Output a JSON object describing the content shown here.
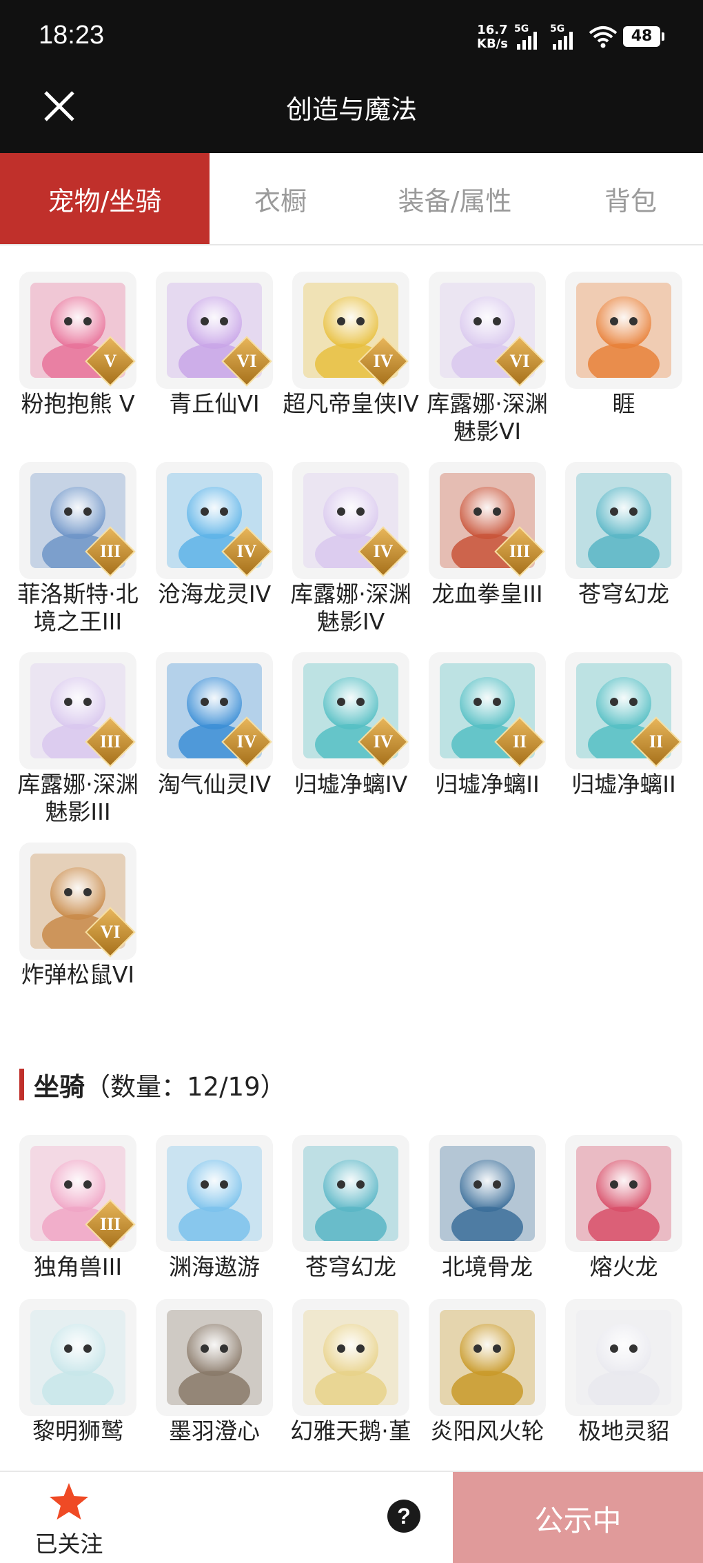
{
  "status": {
    "time": "18:23",
    "net_rate_value": "16.7",
    "net_rate_unit": "KB/s",
    "sim1": "5G",
    "sim2": "5G",
    "battery": "48"
  },
  "header": {
    "title": "创造与魔法",
    "close_icon": "close-icon"
  },
  "tabs": [
    {
      "label": "宠物/坐骑",
      "active": true
    },
    {
      "label": "衣橱",
      "active": false
    },
    {
      "label": "装备/属性",
      "active": false
    },
    {
      "label": "背包",
      "active": false
    }
  ],
  "pets": [
    {
      "name": "粉抱抱熊 V",
      "badge": "V",
      "color": "#e8739a"
    },
    {
      "name": "青丘仙VI",
      "badge": "VI",
      "color": "#c9a6e8"
    },
    {
      "name": "超凡帝皇侠IV",
      "badge": "IV",
      "color": "#e8c040"
    },
    {
      "name": "库露娜·深渊魅影VI",
      "badge": "VI",
      "color": "#d9c8ee"
    },
    {
      "name": "睚",
      "badge": "",
      "color": "#e8813a"
    },
    {
      "name": "菲洛斯特·北境之王III",
      "badge": "III",
      "color": "#6f95c8"
    },
    {
      "name": "沧海龙灵IV",
      "badge": "IV",
      "color": "#5fb4e8"
    },
    {
      "name": "库露娜·深渊魅影IV",
      "badge": "IV",
      "color": "#d9c8ee"
    },
    {
      "name": "龙血拳皇III",
      "badge": "III",
      "color": "#c9553a"
    },
    {
      "name": "苍穹幻龙",
      "badge": "",
      "color": "#5ab6c6"
    },
    {
      "name": "库露娜·深渊魅影III",
      "badge": "III",
      "color": "#d9c8ee"
    },
    {
      "name": "淘气仙灵IV",
      "badge": "IV",
      "color": "#3d8fd6"
    },
    {
      "name": "归墟净螭IV",
      "badge": "IV",
      "color": "#56bfc4"
    },
    {
      "name": "归墟净螭II",
      "badge": "II",
      "color": "#56bfc4"
    },
    {
      "name": "归墟净螭II",
      "badge": "II",
      "color": "#56bfc4"
    },
    {
      "name": "炸弹松鼠VI",
      "badge": "VI",
      "color": "#c98b4a"
    }
  ],
  "mounts_section": {
    "title": "坐骑",
    "count_text": "（数量：12/19）"
  },
  "mounts": [
    {
      "name": "独角兽III",
      "badge": "III",
      "color": "#f0a6c6"
    },
    {
      "name": "渊海遨游",
      "badge": "",
      "color": "#7cc2ec"
    },
    {
      "name": "苍穹幻龙",
      "badge": "",
      "color": "#5ab6c6"
    },
    {
      "name": "北境骨龙",
      "badge": "",
      "color": "#3c6f9a"
    },
    {
      "name": "熔火龙",
      "badge": "",
      "color": "#d8506a"
    },
    {
      "name": "黎明狮鹫",
      "badge": "",
      "color": "#c8e6ea"
    },
    {
      "name": "墨羽澄心",
      "badge": "",
      "color": "#8a7a6a"
    },
    {
      "name": "幻雅天鹅·堇",
      "badge": "",
      "color": "#e8d28a"
    },
    {
      "name": "炎阳风火轮",
      "badge": "",
      "color": "#c99a2a"
    },
    {
      "name": "极地灵貂",
      "badge": "",
      "color": "#e9e9ef"
    }
  ],
  "bottom": {
    "follow_label": "已关注",
    "help_label": "?",
    "cta_label": "公示中"
  },
  "colors": {
    "accent": "#c0302b",
    "cta": "#e09a9a",
    "star": "#ef4a25"
  }
}
